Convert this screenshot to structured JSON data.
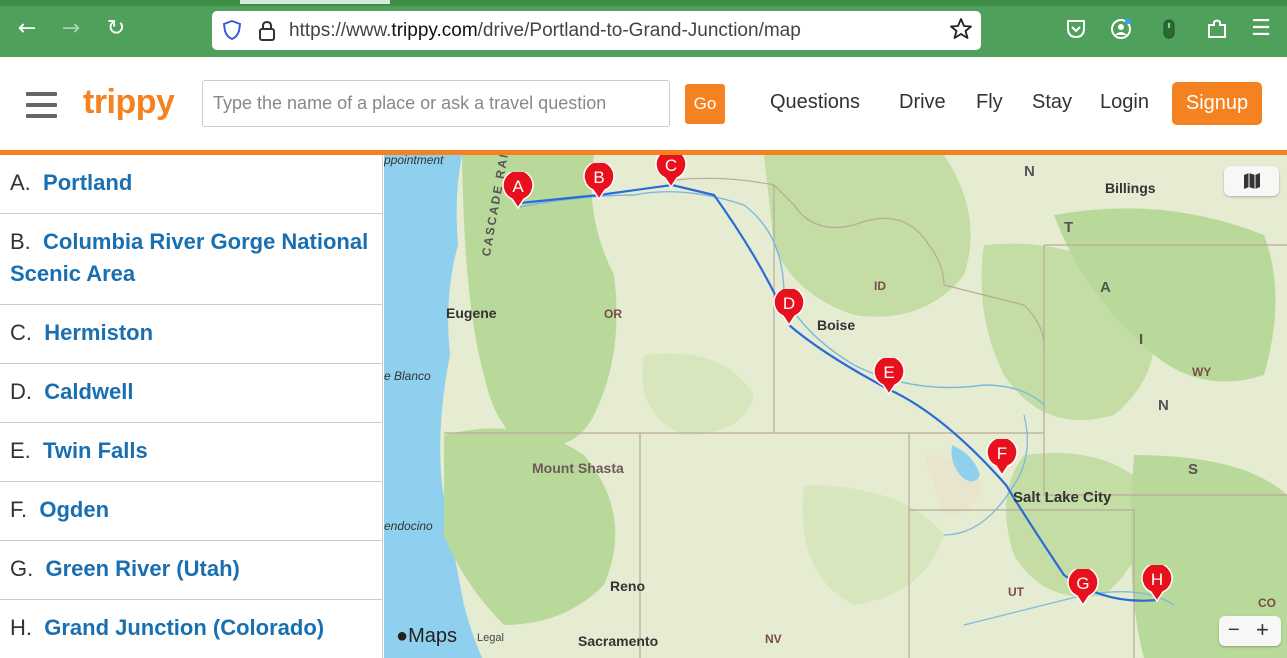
{
  "browser": {
    "url_prefix": "https://www.",
    "url_domain": "trippy.com",
    "url_path": "/drive/Portland-to-Grand-Junction/map"
  },
  "header": {
    "logo": "trippy",
    "search_placeholder": "Type the name of a place or ask a travel question",
    "go_label": "Go",
    "nav": [
      "Questions",
      "Drive",
      "Fly",
      "Stay",
      "Login"
    ],
    "signup_label": "Signup"
  },
  "stops": [
    {
      "letter": "A.",
      "name": "Portland"
    },
    {
      "letter": "B.",
      "name": "Columbia River Gorge National Scenic Area"
    },
    {
      "letter": "C.",
      "name": "Hermiston"
    },
    {
      "letter": "D.",
      "name": "Caldwell"
    },
    {
      "letter": "E.",
      "name": "Twin Falls"
    },
    {
      "letter": "F.",
      "name": "Ogden"
    },
    {
      "letter": "G.",
      "name": "Green River (Utah)"
    },
    {
      "letter": "H.",
      "name": "Grand Junction (Colorado)"
    }
  ],
  "map": {
    "markers": [
      "A",
      "B",
      "C",
      "D",
      "E",
      "F",
      "G",
      "H"
    ],
    "labels": {
      "disappointment": "ppointment",
      "billings": "Billings",
      "eugene": "Eugene",
      "or": "OR",
      "id": "ID",
      "boise": "Boise",
      "blanco": "e Blanco",
      "wy": "WY",
      "mount_shasta": "Mount Shasta",
      "salt_lake_city": "Salt Lake City",
      "mendocino": "endocino",
      "reno": "Reno",
      "ut": "UT",
      "co": "CO",
      "sacramento": "Sacramento",
      "nv": "NV",
      "cascade": "CASCADE RANG",
      "montana_n": "N",
      "montana_t": "T",
      "montana_a": "A",
      "montana_i": "I",
      "montana_n2": "N",
      "montana_s": "S"
    },
    "maps_brand": "Maps",
    "legal": "Legal",
    "zoom_out": "−",
    "zoom_in": "+"
  },
  "colors": {
    "browser_green": "#4fa05a",
    "brand_orange": "#f58220",
    "link_blue": "#1a6fb0",
    "marker_red": "#e8101c",
    "water": "#8fd0ee"
  }
}
